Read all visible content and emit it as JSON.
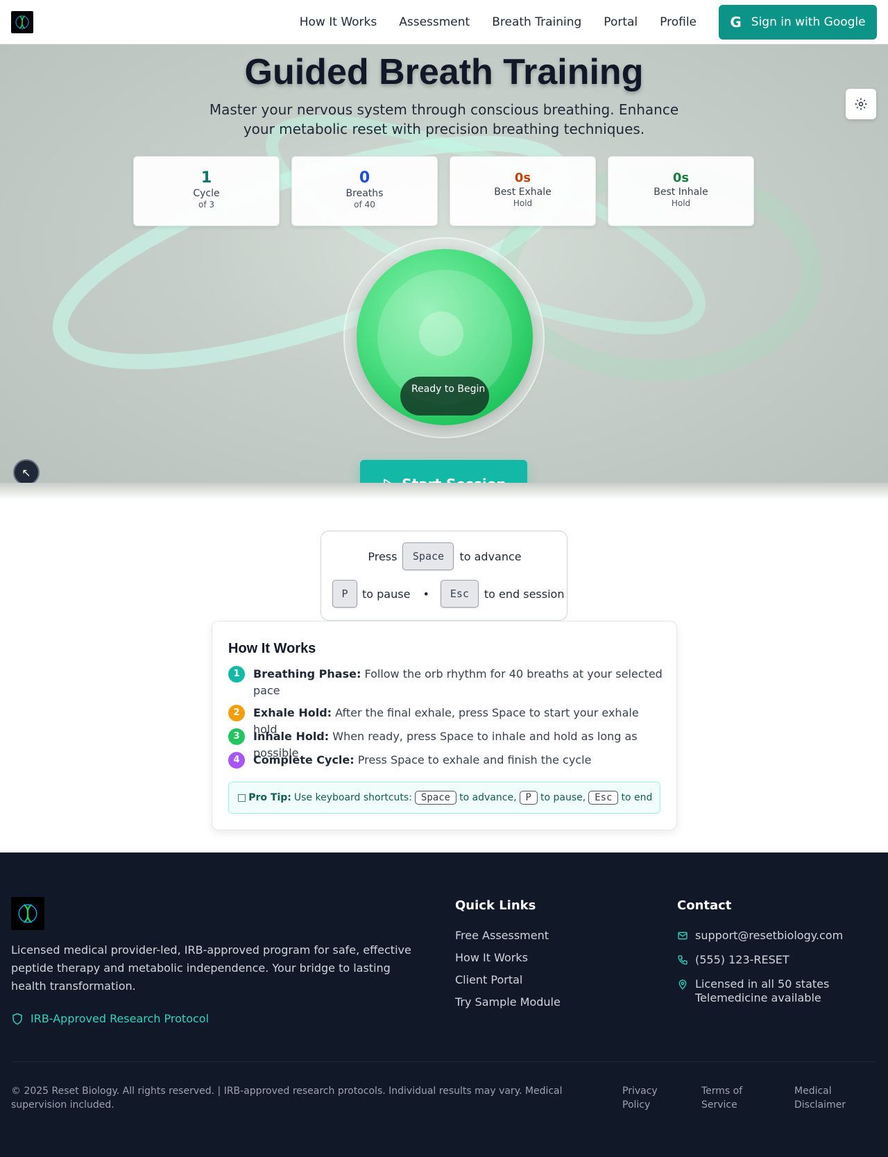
{
  "nav": {
    "links": [
      "How It Works",
      "Assessment",
      "Breath Training",
      "Portal",
      "Profile"
    ],
    "signin_label": "Sign in with Google",
    "signin_icon": "google-g-icon",
    "accent": "#0d9488"
  },
  "hero": {
    "title": "Guided Breath Training",
    "subtitle": "Master your nervous system through conscious breathing. Enhance your metabolic reset with precision breathing techniques.",
    "stats": [
      {
        "value": "1",
        "label": "Cycle",
        "sub": "of 3",
        "color": "#0f766e"
      },
      {
        "value": "0",
        "label": "Breaths",
        "sub": "of 40",
        "color": "#1d4ed8"
      },
      {
        "value": "0s",
        "label": "Best Exhale",
        "sub": "Hold",
        "color": "#c2410c"
      },
      {
        "value": "0s",
        "label": "Best Inhale",
        "sub": "Hold",
        "color": "#15803d"
      }
    ],
    "orb_status": "Ready to Begin",
    "start_label": "Start Session",
    "orb_color": "#22c55e",
    "button_color": "#14b8a6"
  },
  "keys": {
    "press": "Press",
    "space": "Space",
    "advance": "to advance",
    "p": "P",
    "pause": "to pause",
    "dot": "•",
    "esc": "Esc",
    "end": "to end session"
  },
  "how": {
    "title": "How It Works",
    "steps": [
      {
        "n": "1",
        "title": "Breathing Phase:",
        "text": "Follow the orb rhythm for 40 breaths at your selected pace",
        "color": "#14b8a6"
      },
      {
        "n": "2",
        "title": "Exhale Hold:",
        "text": "After the final exhale, press Space to start your exhale hold",
        "color": "#f59e0b"
      },
      {
        "n": "3",
        "title": "Inhale Hold:",
        "text": "When ready, press Space to inhale and hold as long as possible",
        "color": "#22c55e"
      },
      {
        "n": "4",
        "title": "Complete Cycle:",
        "text": "Press Space to exhale and finish the cycle",
        "color": "#a855f7"
      }
    ],
    "tip": {
      "icon": "□",
      "label": "Pro Tip:",
      "text1": "Use keyboard shortcuts:",
      "k1": "Space",
      "t2": "to advance,",
      "k2": "P",
      "t3": "to pause,",
      "k3": "Esc",
      "t4": "to end"
    }
  },
  "footer": {
    "description": "Licensed medical provider-led, IRB-approved program for safe, effective peptide therapy and metabolic independence. Your bridge to lasting health transformation.",
    "irb": "IRB-Approved Research Protocol",
    "quick_title": "Quick Links",
    "quick_links": [
      "Free Assessment",
      "How It Works",
      "Client Portal",
      "Try Sample Module"
    ],
    "contact_title": "Contact",
    "email": "support@resetbiology.com",
    "phone": "(555) 123-RESET",
    "license_line1": "Licensed in all 50 states",
    "license_line2": "Telemedicine available",
    "copyright": "© 2025 Reset Biology. All rights reserved. | IRB-approved research protocols. Individual results may vary. Medical supervision included.",
    "bottom_links": [
      "Privacy Policy",
      "Terms of Service",
      "Medical Disclaimer"
    ]
  }
}
